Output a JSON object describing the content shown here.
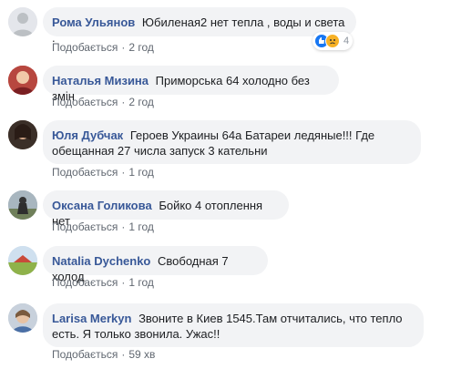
{
  "comments": [
    {
      "author": "Рома Ульянов",
      "text": "Юбиленая2 нет тепла , воды и света .",
      "like_label": "Подобається",
      "time": "2 год",
      "reactions_count": "4"
    },
    {
      "author": "Наталья Мизина",
      "text": "Приморська 64 холодно без змін",
      "like_label": "Подобається",
      "time": "2 год"
    },
    {
      "author": "Юля Дубчак",
      "text_line1": "Героев Украины 64а Батареи ледяные!!! Где",
      "text_line2": "обещанная 27 числа запуск 3 кательни",
      "like_label": "Подобається",
      "time": "1 год"
    },
    {
      "author": "Оксана Голикова",
      "text": "Бойко 4 отоплення нет",
      "like_label": "Подобається",
      "time": "1 год"
    },
    {
      "author": "Natalia Dychenko",
      "text": "Свободная 7 холод",
      "like_label": "Подобається",
      "time": "1 год"
    },
    {
      "author": "Larisa Merkyn",
      "text_line1": "Звоните в Киев 1545.Там отчитались, что тепло",
      "text_line2": "есть. Я только звонила. Ужас!!",
      "like_label": "Подобається",
      "time": "59 хв"
    }
  ],
  "colors": {
    "author": "#385898",
    "bubble": "#f2f3f5",
    "meta": "#606770"
  }
}
